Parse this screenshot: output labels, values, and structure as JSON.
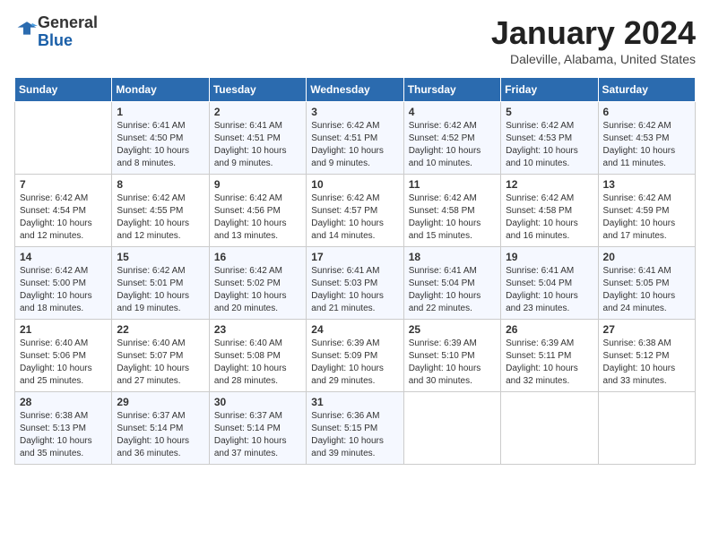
{
  "header": {
    "logo_general": "General",
    "logo_blue": "Blue",
    "month_title": "January 2024",
    "location": "Daleville, Alabama, United States"
  },
  "weekdays": [
    "Sunday",
    "Monday",
    "Tuesday",
    "Wednesday",
    "Thursday",
    "Friday",
    "Saturday"
  ],
  "weeks": [
    [
      {
        "day": "",
        "info": ""
      },
      {
        "day": "1",
        "info": "Sunrise: 6:41 AM\nSunset: 4:50 PM\nDaylight: 10 hours\nand 8 minutes."
      },
      {
        "day": "2",
        "info": "Sunrise: 6:41 AM\nSunset: 4:51 PM\nDaylight: 10 hours\nand 9 minutes."
      },
      {
        "day": "3",
        "info": "Sunrise: 6:42 AM\nSunset: 4:51 PM\nDaylight: 10 hours\nand 9 minutes."
      },
      {
        "day": "4",
        "info": "Sunrise: 6:42 AM\nSunset: 4:52 PM\nDaylight: 10 hours\nand 10 minutes."
      },
      {
        "day": "5",
        "info": "Sunrise: 6:42 AM\nSunset: 4:53 PM\nDaylight: 10 hours\nand 10 minutes."
      },
      {
        "day": "6",
        "info": "Sunrise: 6:42 AM\nSunset: 4:53 PM\nDaylight: 10 hours\nand 11 minutes."
      }
    ],
    [
      {
        "day": "7",
        "info": "Sunrise: 6:42 AM\nSunset: 4:54 PM\nDaylight: 10 hours\nand 12 minutes."
      },
      {
        "day": "8",
        "info": "Sunrise: 6:42 AM\nSunset: 4:55 PM\nDaylight: 10 hours\nand 12 minutes."
      },
      {
        "day": "9",
        "info": "Sunrise: 6:42 AM\nSunset: 4:56 PM\nDaylight: 10 hours\nand 13 minutes."
      },
      {
        "day": "10",
        "info": "Sunrise: 6:42 AM\nSunset: 4:57 PM\nDaylight: 10 hours\nand 14 minutes."
      },
      {
        "day": "11",
        "info": "Sunrise: 6:42 AM\nSunset: 4:58 PM\nDaylight: 10 hours\nand 15 minutes."
      },
      {
        "day": "12",
        "info": "Sunrise: 6:42 AM\nSunset: 4:58 PM\nDaylight: 10 hours\nand 16 minutes."
      },
      {
        "day": "13",
        "info": "Sunrise: 6:42 AM\nSunset: 4:59 PM\nDaylight: 10 hours\nand 17 minutes."
      }
    ],
    [
      {
        "day": "14",
        "info": "Sunrise: 6:42 AM\nSunset: 5:00 PM\nDaylight: 10 hours\nand 18 minutes."
      },
      {
        "day": "15",
        "info": "Sunrise: 6:42 AM\nSunset: 5:01 PM\nDaylight: 10 hours\nand 19 minutes."
      },
      {
        "day": "16",
        "info": "Sunrise: 6:42 AM\nSunset: 5:02 PM\nDaylight: 10 hours\nand 20 minutes."
      },
      {
        "day": "17",
        "info": "Sunrise: 6:41 AM\nSunset: 5:03 PM\nDaylight: 10 hours\nand 21 minutes."
      },
      {
        "day": "18",
        "info": "Sunrise: 6:41 AM\nSunset: 5:04 PM\nDaylight: 10 hours\nand 22 minutes."
      },
      {
        "day": "19",
        "info": "Sunrise: 6:41 AM\nSunset: 5:04 PM\nDaylight: 10 hours\nand 23 minutes."
      },
      {
        "day": "20",
        "info": "Sunrise: 6:41 AM\nSunset: 5:05 PM\nDaylight: 10 hours\nand 24 minutes."
      }
    ],
    [
      {
        "day": "21",
        "info": "Sunrise: 6:40 AM\nSunset: 5:06 PM\nDaylight: 10 hours\nand 25 minutes."
      },
      {
        "day": "22",
        "info": "Sunrise: 6:40 AM\nSunset: 5:07 PM\nDaylight: 10 hours\nand 27 minutes."
      },
      {
        "day": "23",
        "info": "Sunrise: 6:40 AM\nSunset: 5:08 PM\nDaylight: 10 hours\nand 28 minutes."
      },
      {
        "day": "24",
        "info": "Sunrise: 6:39 AM\nSunset: 5:09 PM\nDaylight: 10 hours\nand 29 minutes."
      },
      {
        "day": "25",
        "info": "Sunrise: 6:39 AM\nSunset: 5:10 PM\nDaylight: 10 hours\nand 30 minutes."
      },
      {
        "day": "26",
        "info": "Sunrise: 6:39 AM\nSunset: 5:11 PM\nDaylight: 10 hours\nand 32 minutes."
      },
      {
        "day": "27",
        "info": "Sunrise: 6:38 AM\nSunset: 5:12 PM\nDaylight: 10 hours\nand 33 minutes."
      }
    ],
    [
      {
        "day": "28",
        "info": "Sunrise: 6:38 AM\nSunset: 5:13 PM\nDaylight: 10 hours\nand 35 minutes."
      },
      {
        "day": "29",
        "info": "Sunrise: 6:37 AM\nSunset: 5:14 PM\nDaylight: 10 hours\nand 36 minutes."
      },
      {
        "day": "30",
        "info": "Sunrise: 6:37 AM\nSunset: 5:14 PM\nDaylight: 10 hours\nand 37 minutes."
      },
      {
        "day": "31",
        "info": "Sunrise: 6:36 AM\nSunset: 5:15 PM\nDaylight: 10 hours\nand 39 minutes."
      },
      {
        "day": "",
        "info": ""
      },
      {
        "day": "",
        "info": ""
      },
      {
        "day": "",
        "info": ""
      }
    ]
  ]
}
